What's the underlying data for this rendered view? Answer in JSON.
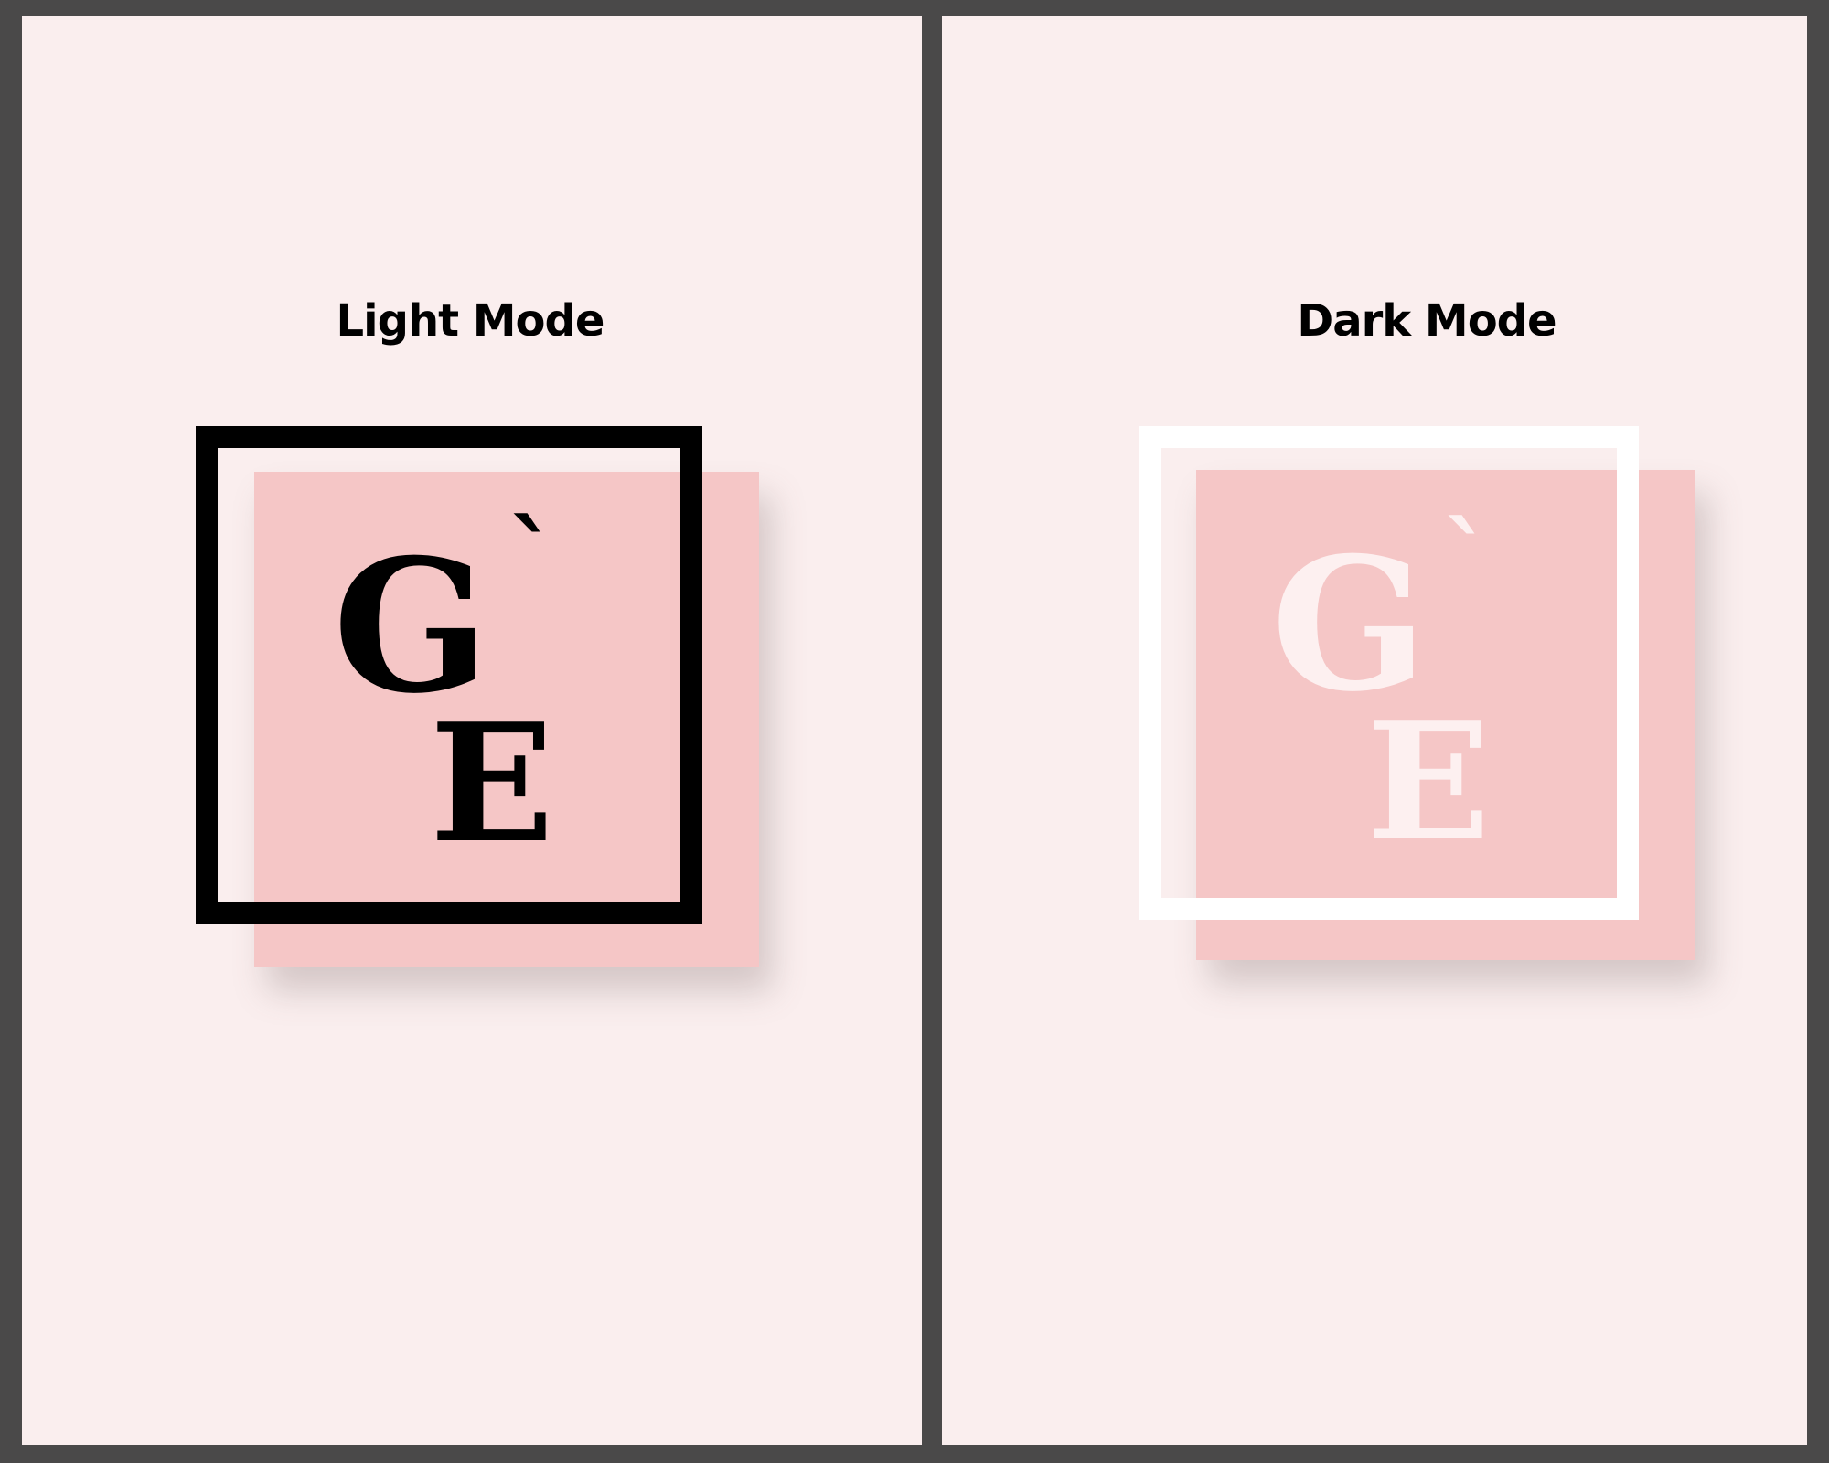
{
  "colors": {
    "outer_frame": "#4a4949",
    "panel_background": "#faeeee",
    "logo_square": "#f5c6c6",
    "light_frame": "#000000",
    "light_letters": "#000000",
    "dark_frame": "#ffffff",
    "dark_letters": "#fdf0f0"
  },
  "panels": {
    "light": {
      "title": "Light Mode",
      "logo": {
        "first_letter": "G",
        "accent": "`",
        "second_letter": "E"
      }
    },
    "dark": {
      "title": "Dark Mode",
      "logo": {
        "first_letter": "G",
        "accent": "`",
        "second_letter": "E"
      }
    }
  }
}
